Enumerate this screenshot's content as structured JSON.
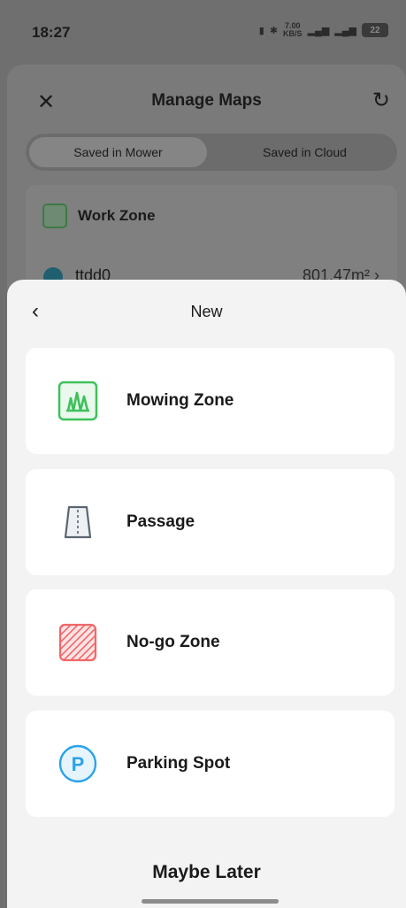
{
  "status_bar": {
    "time": "18:27",
    "network_speed": "7.00",
    "network_unit": "KB/S",
    "battery": "22"
  },
  "background_screen": {
    "title": "Manage Maps",
    "tabs": [
      {
        "label": "Saved in Mower",
        "selected": true
      },
      {
        "label": "Saved in Cloud",
        "selected": false
      }
    ],
    "work_zone_label": "Work Zone",
    "map_name": "ttdd0",
    "map_area": "801.47m²"
  },
  "sheet": {
    "title": "New",
    "options": [
      {
        "label": "Mowing Zone",
        "icon": "grass-icon"
      },
      {
        "label": "Passage",
        "icon": "passage-icon"
      },
      {
        "label": "No-go Zone",
        "icon": "no-go-icon"
      },
      {
        "label": "Parking Spot",
        "icon": "parking-icon"
      }
    ],
    "dismiss_label": "Maybe Later"
  },
  "colors": {
    "mowing_green": "#3ec15a",
    "passage_gray": "#5b6570",
    "nogo_red": "#f0686a",
    "parking_blue": "#2ba3e8"
  }
}
